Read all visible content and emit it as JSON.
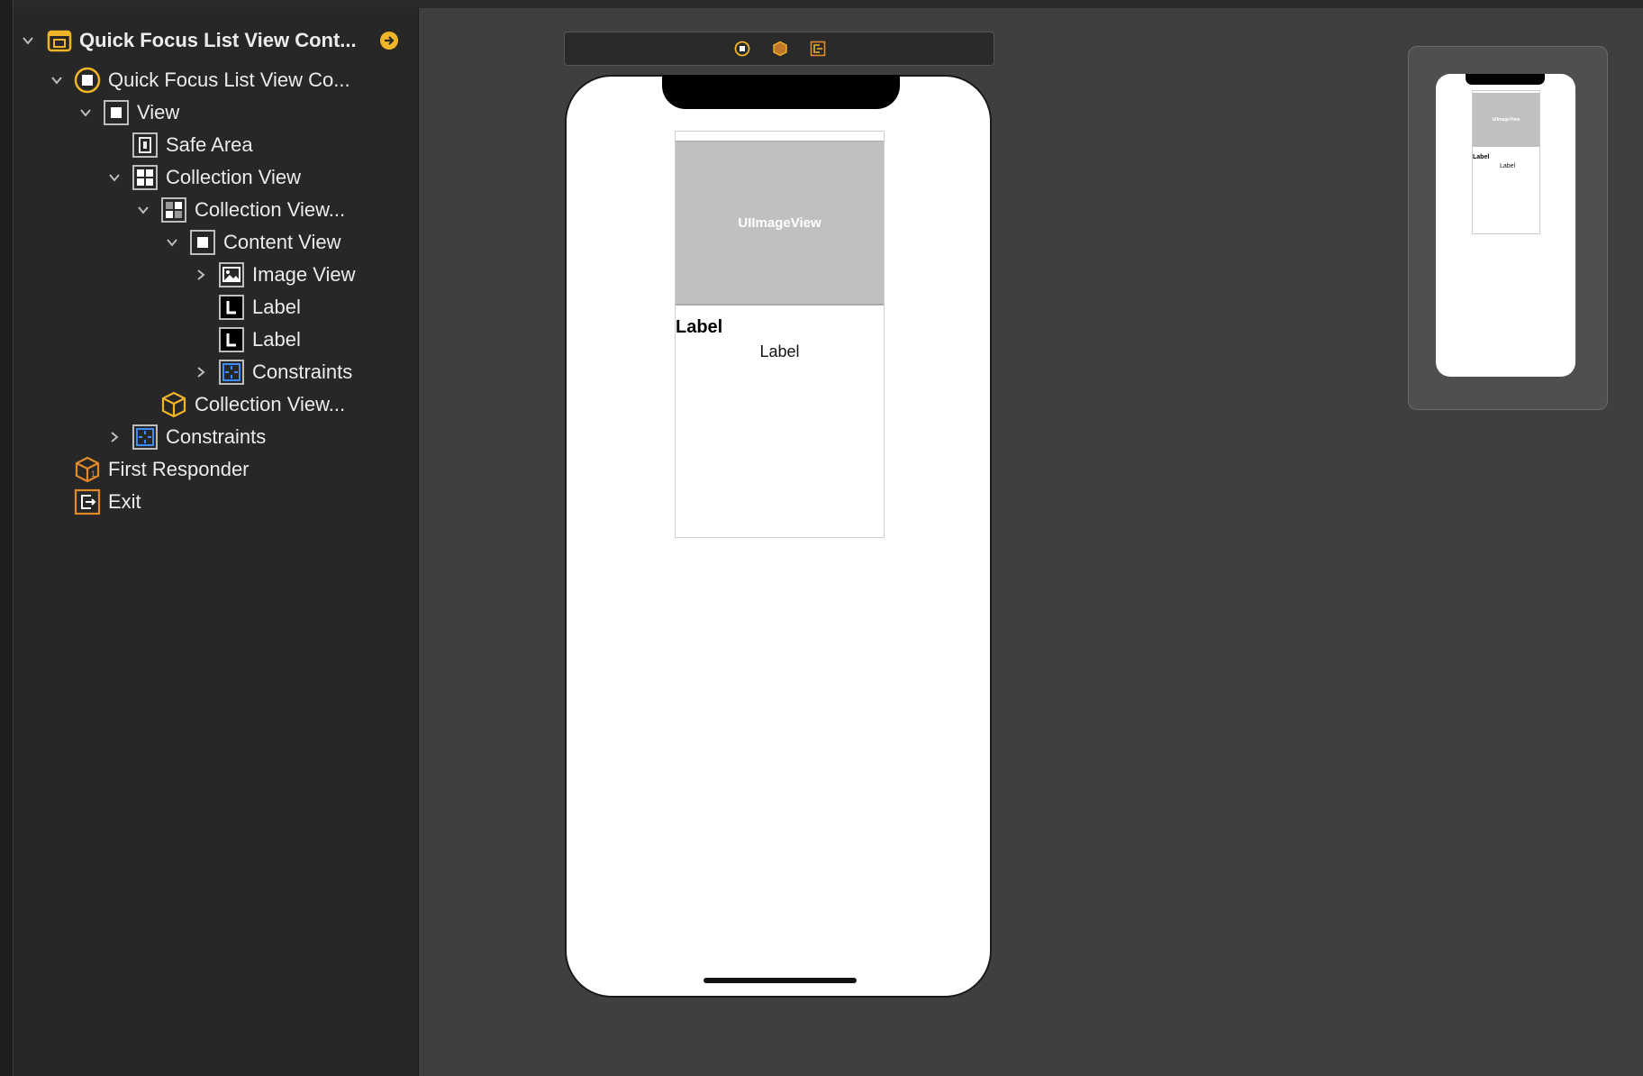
{
  "outline": {
    "scene_title": "Quick Focus List View Cont...",
    "items": [
      {
        "label": "Quick Focus List View Co...",
        "icon": "view-controller-icon"
      },
      {
        "label": "View",
        "icon": "view-icon"
      },
      {
        "label": "Safe Area",
        "icon": "safe-area-icon"
      },
      {
        "label": "Collection View",
        "icon": "collection-view-icon"
      },
      {
        "label": "Collection View...",
        "icon": "collection-view-cell-icon"
      },
      {
        "label": "Content View",
        "icon": "view-icon"
      },
      {
        "label": "Image View",
        "icon": "image-view-icon"
      },
      {
        "label": "Label",
        "icon": "label-icon"
      },
      {
        "label": "Label",
        "icon": "label-icon"
      },
      {
        "label": "Constraints",
        "icon": "constraints-icon"
      },
      {
        "label": "Collection View...",
        "icon": "cube-icon"
      },
      {
        "label": "Constraints",
        "icon": "constraints-icon"
      },
      {
        "label": "First Responder",
        "icon": "first-responder-icon"
      },
      {
        "label": "Exit",
        "icon": "exit-icon"
      }
    ]
  },
  "canvas": {
    "image_view_text": "UIImageView",
    "label_title": "Label",
    "label_subtitle": "Label",
    "minimap": {
      "image_view_text": "UIImageView",
      "label_title": "Label",
      "label_subtitle": "Label"
    }
  },
  "colors": {
    "accent_orange": "#f0b429",
    "constraint_blue": "#3a8cff",
    "canvas_bg": "#3f3f3f",
    "outline_bg": "#272727"
  }
}
